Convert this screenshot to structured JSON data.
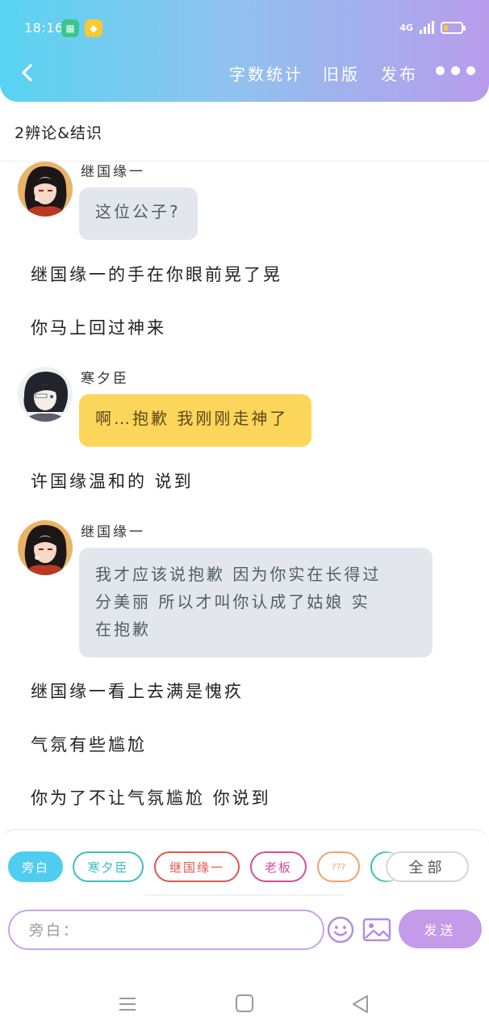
{
  "status_bar": {
    "time": "18:16",
    "app_icons": [
      "calendar-app-icon",
      "diamond-app-icon"
    ],
    "network": "4G",
    "battery_level": 0.25
  },
  "nav": {
    "back_icon": "chevron-left-icon",
    "word_count_label": "字数统计",
    "old_version_label": "旧版",
    "publish_label": "发布",
    "more_icon": "more-dots-icon"
  },
  "chapter_title": "2辨论&结识",
  "messages": [
    {
      "type": "dialogue",
      "speaker": "继国缘一",
      "text": "这位公子?",
      "bubble_color": "#e3e7ed"
    },
    {
      "type": "narration",
      "text": "继国缘一的手在你眼前晃了晃"
    },
    {
      "type": "narration",
      "text": "你马上回过神来"
    },
    {
      "type": "dialogue",
      "speaker": "寒夕臣",
      "text": "啊…抱歉 我刚刚走神了",
      "bubble_color": "#fcd65a"
    },
    {
      "type": "narration",
      "text": "许国缘温和的 说到"
    },
    {
      "type": "dialogue",
      "speaker": "继国缘一",
      "text_lines": [
        "我才应该说抱歉 因为你实在长得过",
        "分美丽 所以才叫你认成了姑娘 实",
        "在抱歉"
      ],
      "bubble_color": "#e3e7ed"
    },
    {
      "type": "narration",
      "text": "继国缘一看上去满是愧疚"
    },
    {
      "type": "narration",
      "text": "气氛有些尴尬"
    },
    {
      "type": "narration",
      "text": "你为了不让气氛尴尬 你说到"
    }
  ],
  "roles": [
    {
      "label": "旁白",
      "color": "#4fcdf0",
      "selected": true
    },
    {
      "label": "寒夕臣",
      "color": "#3cbdc3",
      "selected": false
    },
    {
      "label": "继国缘一",
      "color": "#e0574c",
      "selected": false
    },
    {
      "label": "老板",
      "color": "#d94c96",
      "selected": false
    },
    {
      "label": "???",
      "color": "#f1a36b",
      "selected": false
    }
  ],
  "all_roles_label": "全部",
  "input": {
    "placeholder": "旁白：",
    "emoji_icon": "emoji-icon",
    "image_icon": "image-icon",
    "send_label": "发送"
  },
  "system_nav": {
    "menu_icon": "menu-icon",
    "home_icon": "home-icon",
    "back_icon": "back-triangle-icon"
  }
}
